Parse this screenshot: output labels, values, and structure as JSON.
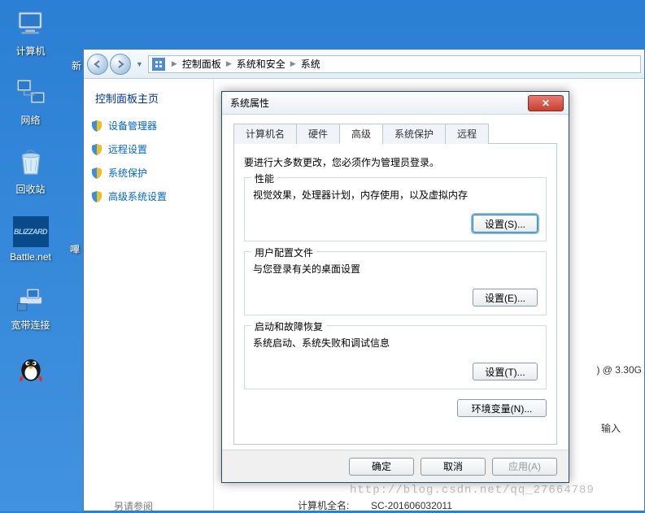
{
  "desktop": {
    "items": [
      {
        "label": "计算机"
      },
      {
        "label": "网络"
      },
      {
        "label": "回收站"
      },
      {
        "label": "Battle.net"
      },
      {
        "label": "宽带连接"
      }
    ],
    "partial": "新"
  },
  "explorer": {
    "breadcrumbs": [
      "控制面板",
      "系统和安全",
      "系统"
    ],
    "cp_home": "控制面板主页",
    "side_links": [
      "设备管理器",
      "远程设置",
      "系统保护",
      "高级系统设置"
    ],
    "see_also": "另请参阅",
    "computer_name_label": "计算机全名:",
    "computer_name_value": "SC-201606032011",
    "cpu_partial": "@ 3.30G",
    "input_partial": "输入"
  },
  "dialog": {
    "title": "系统属性",
    "tabs": [
      "计算机名",
      "硬件",
      "高级",
      "系统保护",
      "远程"
    ],
    "active_tab": 2,
    "intro": "要进行大多数更改，您必须作为管理员登录。",
    "groups": {
      "perf": {
        "title": "性能",
        "desc": "视觉效果，处理器计划，内存使用，以及虚拟内存",
        "btn": "设置(S)..."
      },
      "profile": {
        "title": "用户配置文件",
        "desc": "与您登录有关的桌面设置",
        "btn": "设置(E)..."
      },
      "startup": {
        "title": "启动和故障恢复",
        "desc": "系统启动、系统失败和调试信息",
        "btn": "设置(T)..."
      }
    },
    "env_btn": "环境变量(N)...",
    "footer": {
      "ok": "确定",
      "cancel": "取消",
      "apply": "应用(A)"
    }
  },
  "watermark": "http://blog.csdn.net/qq_27664789"
}
